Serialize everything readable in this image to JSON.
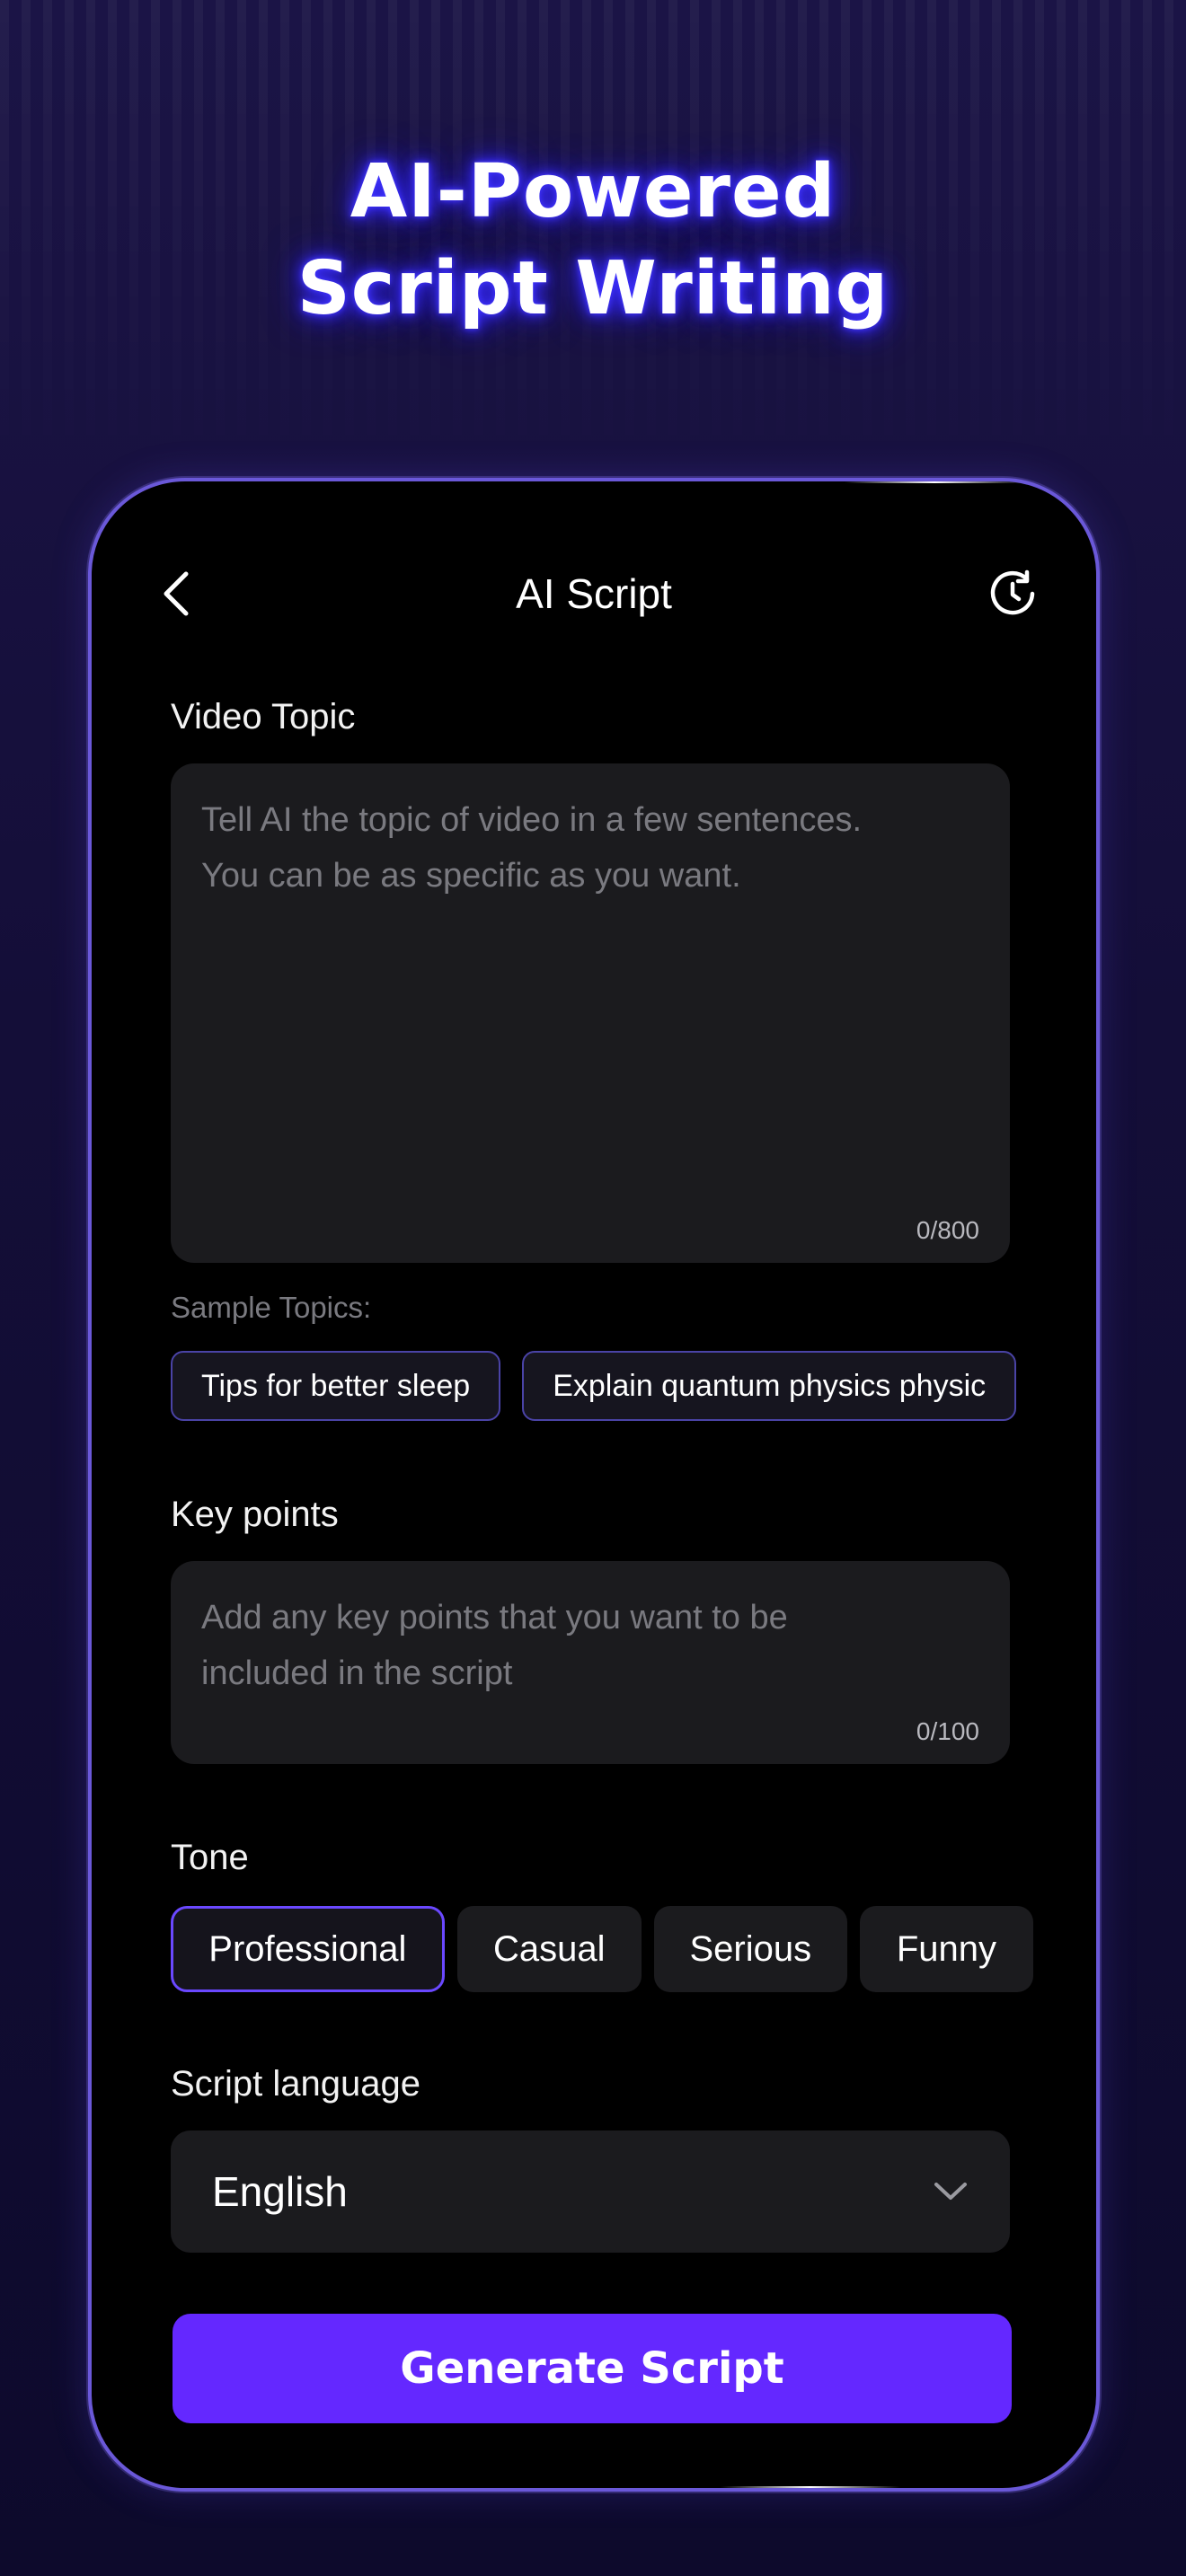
{
  "headline": {
    "line1": "AI-Powered",
    "line2": "Script Writing"
  },
  "colors": {
    "accent": "#6428ff",
    "selected_border": "#6a48ff",
    "field_background": "#1b1b1e",
    "glow": "#3f32ff"
  },
  "navbar": {
    "title": "AI Script",
    "back_icon": "chevron-left-icon",
    "history_icon": "history-icon"
  },
  "video_topic": {
    "label": "Video Topic",
    "placeholder": "Tell AI the topic of video in a few sentences.\nYou can be as specific as you want.",
    "value": "",
    "counter": "0/800"
  },
  "sample_topics": {
    "label": "Sample Topics:",
    "items": [
      "Tips for better sleep",
      "Explain quantum physics physic"
    ]
  },
  "key_points": {
    "label": "Key points",
    "placeholder": "Add any key points that you want to be\nincluded in the script",
    "value": "",
    "counter": "0/100"
  },
  "tone": {
    "label": "Tone",
    "options": [
      "Professional",
      "Casual",
      "Serious",
      "Funny"
    ],
    "selected": "Professional"
  },
  "script_language": {
    "label": "Script language",
    "selected": "English",
    "dropdown_icon": "chevron-down-icon"
  },
  "generate_button": {
    "label": "Generate Script"
  }
}
